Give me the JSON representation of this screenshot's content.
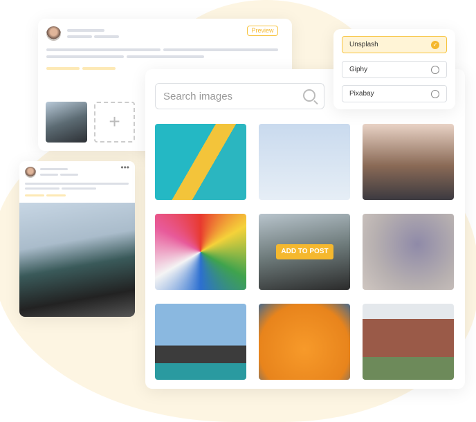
{
  "colors": {
    "accent": "#f5b82e",
    "background_blob": "#fdf5e2"
  },
  "preview_card": {
    "badge": "Preview",
    "add_icon": "plus-icon"
  },
  "post_card": {
    "menu_icon": "more-dots-icon"
  },
  "source_picker": {
    "options": [
      {
        "label": "Unsplash",
        "selected": true
      },
      {
        "label": "Giphy",
        "selected": false
      },
      {
        "label": "Pixabay",
        "selected": false
      }
    ]
  },
  "search": {
    "placeholder": "Search images",
    "icon": "search-icon"
  },
  "grid": {
    "hover_button": "ADD TO POST",
    "images": [
      "climbing wall",
      "roller coaster",
      "friends with guitar",
      "abstract paint",
      "friends jumping",
      "confetti",
      "cliff jumping",
      "ball pit",
      "friends in backyard"
    ]
  }
}
